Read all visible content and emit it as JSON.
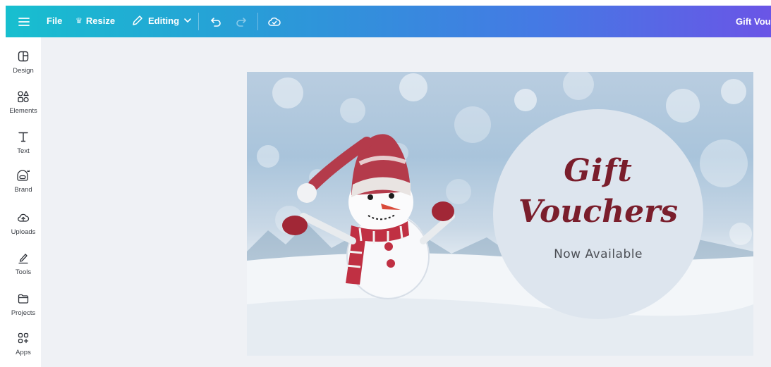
{
  "topbar": {
    "menu_icon": "hamburger-icon",
    "file_label": "File",
    "resize_label": "Resize",
    "resize_icon": "crown-icon",
    "editing_label": "Editing",
    "editing_icon": "pencil-icon",
    "undo_icon": "undo-icon",
    "redo_icon": "redo-icon",
    "save_icon": "cloud-check-icon",
    "document_title": "Gift Vouc",
    "gradient": [
      "#17bfcf",
      "#4579e4",
      "#6a55e6"
    ]
  },
  "sidebar": {
    "items": [
      {
        "label": "Design",
        "icon": "design-icon"
      },
      {
        "label": "Elements",
        "icon": "elements-icon"
      },
      {
        "label": "Text",
        "icon": "text-icon"
      },
      {
        "label": "Brand",
        "icon": "brand-icon"
      },
      {
        "label": "Uploads",
        "icon": "upload-icon"
      },
      {
        "label": "Tools",
        "icon": "tools-icon"
      },
      {
        "label": "Projects",
        "icon": "folder-icon"
      },
      {
        "label": "Apps",
        "icon": "apps-icon"
      }
    ]
  },
  "canvas": {
    "heading_line1": "Gift",
    "heading_line2": "Vouchers",
    "subheading": "Now Available",
    "text_color": "#7a1e2c",
    "circle_color": "#dde5ee"
  }
}
